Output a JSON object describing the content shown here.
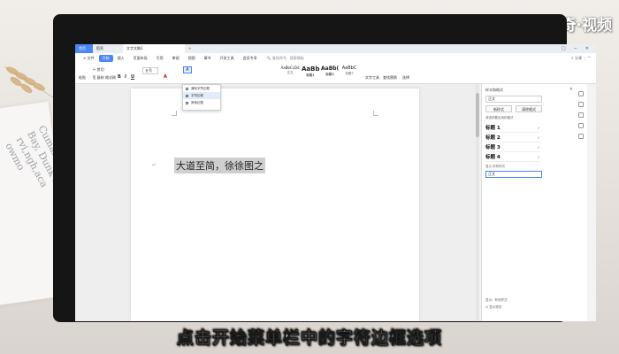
{
  "watermark": "天奇·视频",
  "caption": "点击开始菜单栏中的字符边框选项",
  "notebook_text": "Cumaliu\nBay, Dunk Ra\nrvi,ngh,aca\nowmo",
  "tabs": [
    {
      "label": "首页"
    },
    {
      "label": "稻壳"
    },
    {
      "label": "文字文稿1"
    }
  ],
  "tab_plus": "+",
  "window_controls": "□ ─ ✕",
  "menu": {
    "items": [
      "≡ 文件",
      "开始",
      "插入",
      "页面布局",
      "引用",
      "审阅",
      "视图",
      "章节",
      "开发工具",
      "会员专享"
    ],
    "active_index": 1,
    "search": "🔍 查找命令、搜索模板",
    "right": "⇧ 分享  ⋮  ^"
  },
  "ribbon": {
    "paste": "粘贴",
    "cut": "✂ 剪切",
    "copy": "⎘ 复制",
    "format_painter": "格式刷",
    "font_size": "五号",
    "bold": "B",
    "italic": "I",
    "underline": "U",
    "font_color": "A",
    "styles": [
      {
        "sample": "AaBbCcDd",
        "name": "正文"
      },
      {
        "sample": "AaBb",
        "name": "标题1"
      },
      {
        "sample": "AaBb(",
        "name": "标题2"
      },
      {
        "sample": "AaBbC",
        "name": "标题3"
      }
    ],
    "text_tool": "文字工具",
    "find_replace": "查找替换",
    "select": "选择"
  },
  "dropdown": {
    "items": [
      "清除字符边框",
      "字符边框",
      "其他边框"
    ],
    "selected_index": 1
  },
  "document": {
    "text": "大道至简，徐徐图之",
    "para_mark": "↵"
  },
  "right_panel": {
    "title": "样式和格式",
    "close": "×",
    "current_style": "正文",
    "new_style_btn": "新样式",
    "clear_format_btn": "清除格式",
    "section_label": "请选择要应用的格式",
    "styles": [
      "标题 1",
      "标题 2",
      "标题 3",
      "标题 4"
    ],
    "display_label": "显示 所有样式",
    "display_value": "正文",
    "footer_show": "显示：有效样式",
    "footer_preview": "☑ 显示预览"
  }
}
